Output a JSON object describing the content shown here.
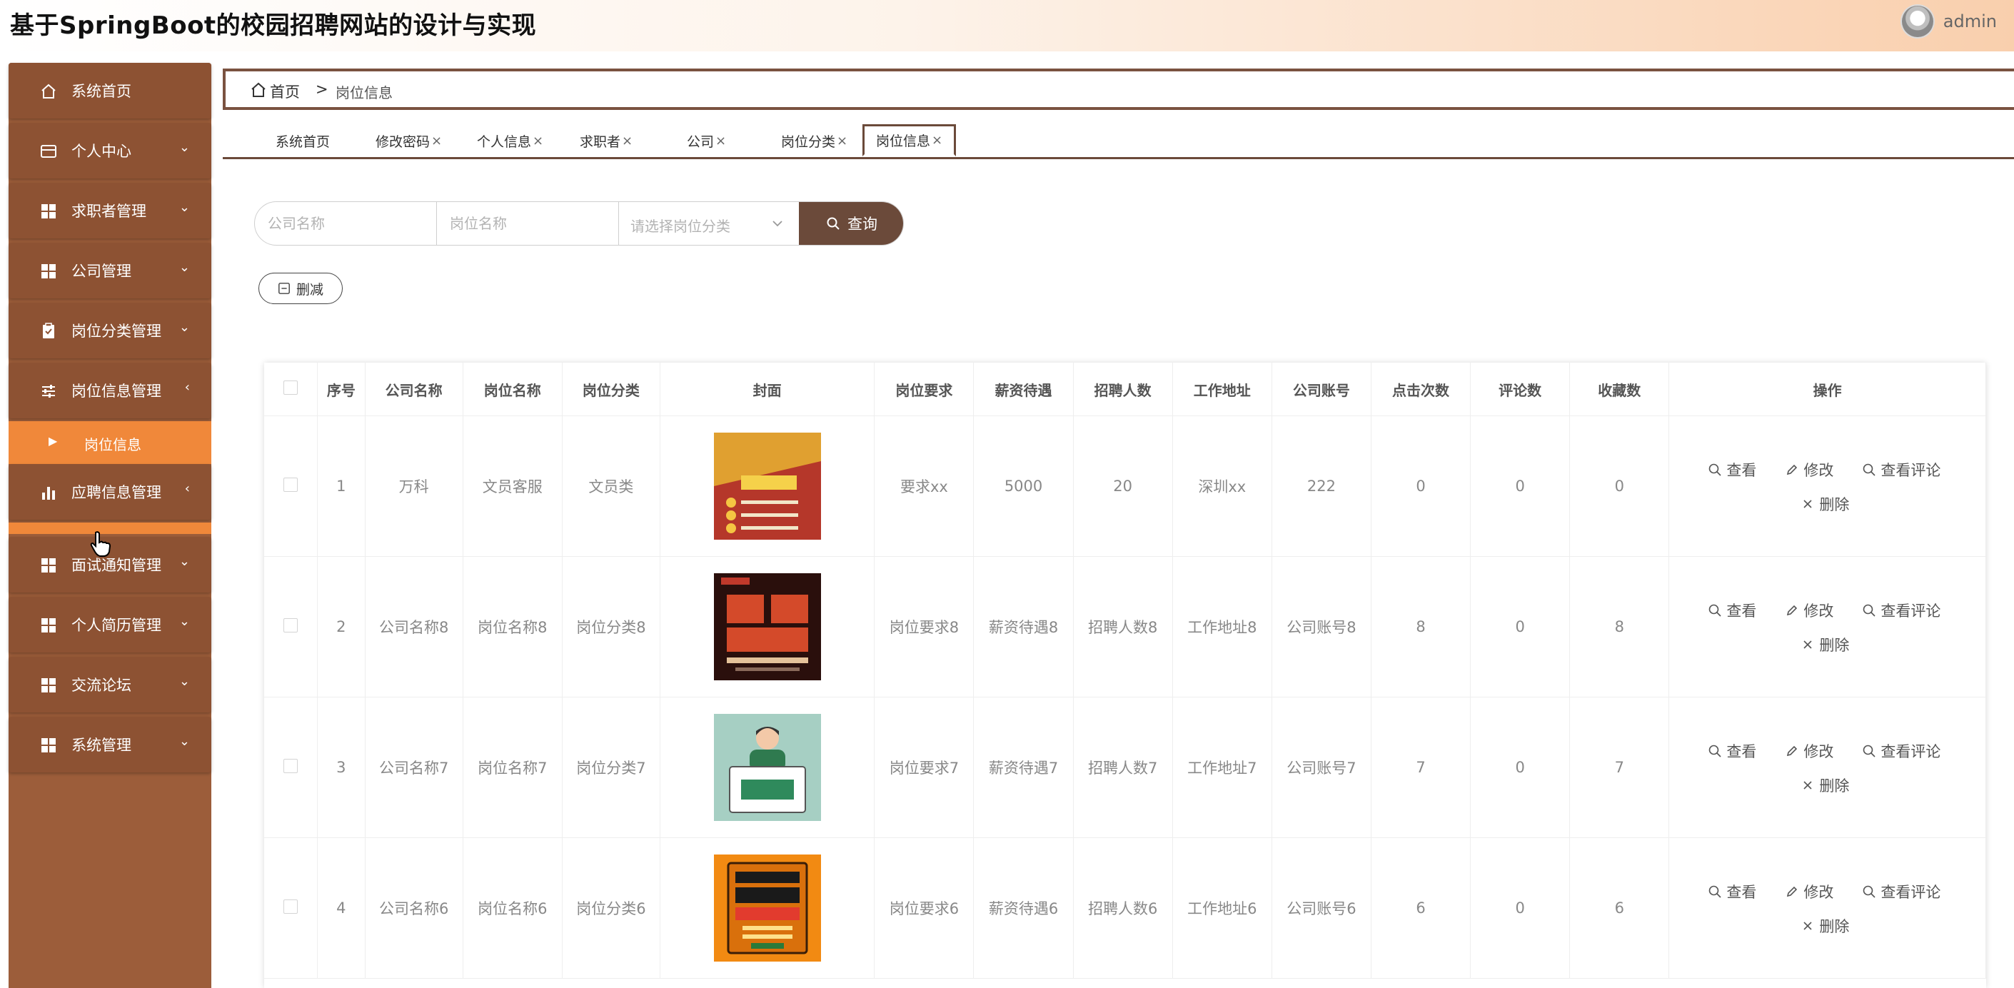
{
  "header": {
    "title": "基于SpringBoot的校园招聘网站的设计与实现",
    "username": "admin"
  },
  "sidebar": {
    "items": [
      {
        "label": "系统首页",
        "icon": "home-icon",
        "arrow": ""
      },
      {
        "label": "个人中心",
        "icon": "card-icon",
        "arrow": "⌄"
      },
      {
        "label": "求职者管理",
        "icon": "grid-icon",
        "arrow": "⌄"
      },
      {
        "label": "公司管理",
        "icon": "grid-icon",
        "arrow": "⌄"
      },
      {
        "label": "岗位分类管理",
        "icon": "clipboard-icon",
        "arrow": "⌄"
      },
      {
        "label": "岗位信息管理",
        "icon": "sliders-icon",
        "arrow": "‹"
      },
      {
        "label": "应聘信息管理",
        "icon": "bar-chart-icon",
        "arrow": "‹"
      },
      {
        "label": "面试通知管理",
        "icon": "grid-icon",
        "arrow": "⌄"
      },
      {
        "label": "个人简历管理",
        "icon": "grid-icon",
        "arrow": "⌄"
      },
      {
        "label": "交流论坛",
        "icon": "grid-icon",
        "arrow": "⌄"
      },
      {
        "label": "系统管理",
        "icon": "grid-icon",
        "arrow": "⌄"
      }
    ],
    "sub_item": {
      "label": "岗位信息"
    }
  },
  "breadcrumb": {
    "home": "首页",
    "separator": ">",
    "current": "岗位信息"
  },
  "tabs": [
    {
      "label": "系统首页",
      "closable": false
    },
    {
      "label": "修改密码",
      "closable": true
    },
    {
      "label": "个人信息",
      "closable": true
    },
    {
      "label": "求职者",
      "closable": true
    },
    {
      "label": "公司",
      "closable": true
    },
    {
      "label": "岗位分类",
      "closable": true
    },
    {
      "label": "岗位信息",
      "closable": true,
      "active": true
    }
  ],
  "tab_close_glyph": "×",
  "search": {
    "company_placeholder": "公司名称",
    "position_placeholder": "岗位名称",
    "category_placeholder": "请选择岗位分类",
    "button_label": "查询"
  },
  "delete_button_label": "删减",
  "table": {
    "headers": [
      "序号",
      "公司名称",
      "岗位名称",
      "岗位分类",
      "封面",
      "岗位要求",
      "薪资待遇",
      "招聘人数",
      "工作地址",
      "公司账号",
      "点击次数",
      "评论数",
      "收藏数",
      "操作"
    ],
    "rows": [
      {
        "no": "1",
        "company": "万科",
        "position": "文员客服",
        "category": "文员类",
        "cover": "poster-recruit-red",
        "requirement": "要求xx",
        "salary": "5000",
        "headcount": "20",
        "address": "深圳xx",
        "account": "222",
        "clicks": "0",
        "comments": "0",
        "favorites": "0"
      },
      {
        "no": "2",
        "company": "公司名称8",
        "position": "岗位名称8",
        "category": "岗位分类8",
        "cover": "poster-brave-dark",
        "requirement": "岗位要求8",
        "salary": "薪资待遇8",
        "headcount": "招聘人数8",
        "address": "工作地址8",
        "account": "公司账号8",
        "clicks": "8",
        "comments": "0",
        "favorites": "8"
      },
      {
        "no": "3",
        "company": "公司名称7",
        "position": "岗位名称7",
        "category": "岗位分类7",
        "cover": "poster-hiring-sign",
        "requirement": "岗位要求7",
        "salary": "薪资待遇7",
        "headcount": "招聘人数7",
        "address": "工作地址7",
        "account": "公司账号7",
        "clicks": "7",
        "comments": "0",
        "favorites": "7"
      },
      {
        "no": "4",
        "company": "公司名称6",
        "position": "岗位名称6",
        "category": "岗位分类6",
        "cover": "poster-job-orange",
        "requirement": "岗位要求6",
        "salary": "薪资待遇6",
        "headcount": "招聘人数6",
        "address": "工作地址6",
        "account": "公司账号6",
        "clicks": "6",
        "comments": "0",
        "favorites": "6"
      }
    ],
    "actions": {
      "view": "查看",
      "edit": "修改",
      "view_comments": "查看评论",
      "delete": "删除"
    }
  },
  "colors": {
    "sidebar": "#9c5d3a",
    "sidebar_item": "#8d5233",
    "accent_orange": "#f0883a",
    "dark_brown": "#6b4a3a"
  }
}
